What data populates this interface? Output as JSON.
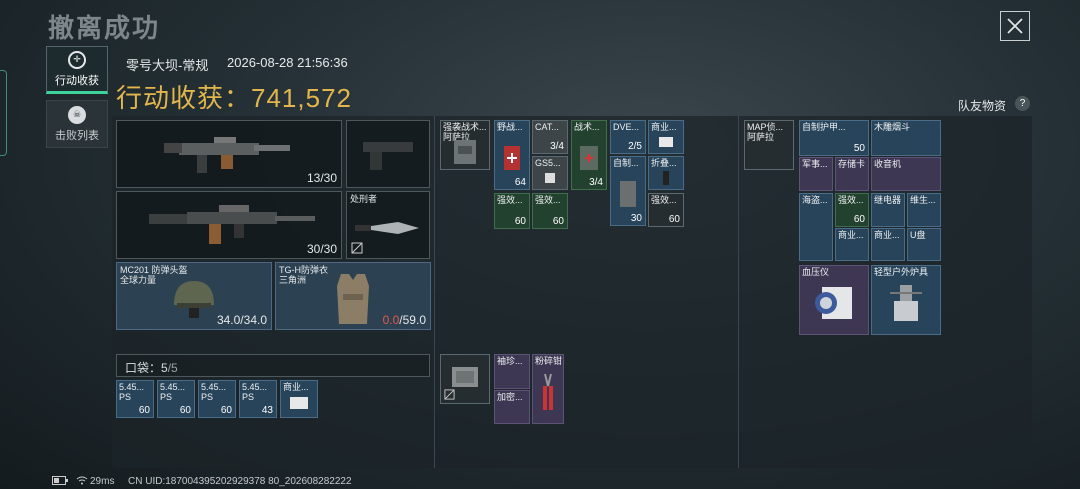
{
  "header": {
    "title": "撤离成功"
  },
  "tabs": [
    {
      "label": "行动收获",
      "icon": "target-icon",
      "active": true
    },
    {
      "label": "击败列表",
      "icon": "skull-icon",
      "active": false
    }
  ],
  "match": {
    "map": "零号大坝-常规",
    "datetime": "2026-08-28 21:56:36"
  },
  "harvest": {
    "label": "行动收获：",
    "value": "741,572"
  },
  "teammate_items": {
    "label": "队友物资",
    "help": "?"
  },
  "equipment": {
    "primary_weapon": {
      "ammo": "13/30"
    },
    "secondary_weapon": {
      "ammo": "30/30"
    },
    "melee": {
      "name": "处刑者"
    },
    "helmet": {
      "name": "MC201 防弹头盔",
      "faction": "全球力量",
      "durability": "34.0/34.0"
    },
    "armor": {
      "name": "TG-H防弹衣",
      "faction": "三角洲",
      "durability_current": "0.0",
      "durability_max": "/59.0"
    }
  },
  "pocket": {
    "label": "口袋：",
    "count": "5",
    "capacity": "/5",
    "items": [
      {
        "name": "5.45...",
        "sub": "PS",
        "value": "60"
      },
      {
        "name": "5.45...",
        "sub": "PS",
        "value": "60"
      },
      {
        "name": "5.45...",
        "sub": "PS",
        "value": "60"
      },
      {
        "name": "5.45...",
        "sub": "PS",
        "value": "43"
      },
      {
        "name": "商业...",
        "sub": "",
        "value": ""
      }
    ]
  },
  "backpack_items": [
    {
      "name": "强袭战术...",
      "sub": "阿萨拉"
    },
    {
      "name": "野战...",
      "value": "64"
    },
    {
      "name": "CAT...",
      "value": "3/4"
    },
    {
      "name": "GS5...",
      "value": ""
    },
    {
      "name": "战术...",
      "value": "3/4"
    },
    {
      "name": "DVE...",
      "value": "2/5"
    },
    {
      "name": "商业...",
      "value": ""
    },
    {
      "name": "自制...",
      "value": "30"
    },
    {
      "name": "折叠...",
      "value": ""
    },
    {
      "name": "强效...",
      "value": "60"
    },
    {
      "name": "强效...",
      "value": "60"
    },
    {
      "name": "强效...",
      "value": "60"
    }
  ],
  "case_items": [
    {
      "name": "袖珍..."
    },
    {
      "name": "粉碎钳"
    },
    {
      "name": "加密..."
    }
  ],
  "teammate_grid": [
    {
      "name": "MAP侦...",
      "sub": "阿萨拉"
    },
    {
      "name": "自制护甲...",
      "value": "50"
    },
    {
      "name": "木雕烟斗"
    },
    {
      "name": "军事..."
    },
    {
      "name": "存储卡"
    },
    {
      "name": "收音机"
    },
    {
      "name": "海盗..."
    },
    {
      "name": "强效...",
      "value": "60"
    },
    {
      "name": "继电器"
    },
    {
      "name": "维生..."
    },
    {
      "name": "商业..."
    },
    {
      "name": "商业..."
    },
    {
      "name": "U盘"
    },
    {
      "name": "血压仪"
    },
    {
      "name": "轻型户外炉具"
    }
  ],
  "status_bar": {
    "ping": "29ms",
    "uid": "CN UID:187004395202929378 80_202608282222"
  }
}
